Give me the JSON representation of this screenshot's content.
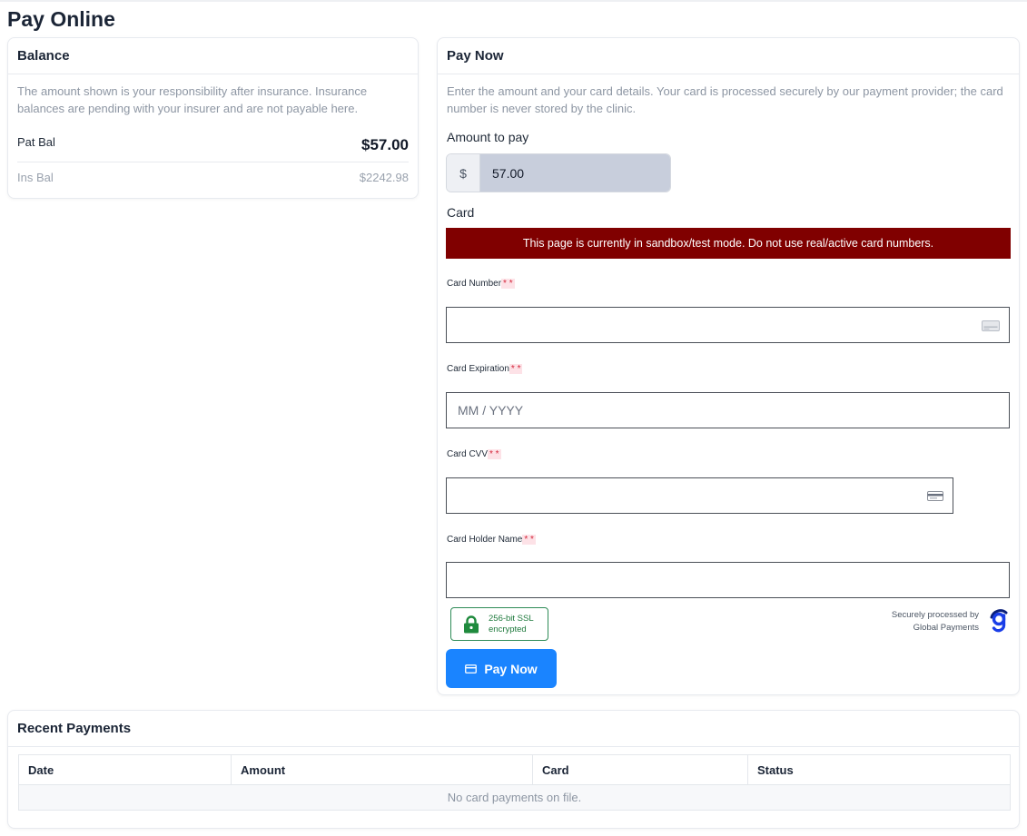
{
  "page": {
    "title": "Pay Online"
  },
  "balance": {
    "header": "Balance",
    "description": "The amount shown is your responsibility after insurance. Insurance balances are pending with your insurer and are not payable here.",
    "patient_label": "Pat Bal",
    "patient_value": "$57.00",
    "insurance_label": "Ins Bal",
    "insurance_value": "$2242.98"
  },
  "pay": {
    "header": "Pay Now",
    "description": "Enter the amount and your card details. Your card is processed securely by our payment provider; the card number is never stored by the clinic.",
    "amount_label": "Amount to pay",
    "currency_symbol": "$",
    "amount_value": "57.00",
    "card_label": "Card",
    "sandbox_notice": "This page is currently in sandbox/test mode. Do not use real/active card numbers.",
    "required_marker": "* *",
    "fields": {
      "card_number": {
        "label": "Card Number",
        "placeholder": "",
        "icon": "credit-card-icon"
      },
      "card_expiration": {
        "label": "Card Expiration",
        "placeholder": "MM / YYYY"
      },
      "card_cvv": {
        "label": "Card CVV",
        "placeholder": "",
        "icon": "card-back-icon"
      },
      "card_holder": {
        "label": "Card Holder Name",
        "placeholder": ""
      }
    },
    "ssl_badge": {
      "line1": "256-bit SSL",
      "line2": "encrypted",
      "icon": "lock-icon"
    },
    "processor": {
      "line1": "Securely processed by",
      "line2": "Global Payments",
      "logo": "global-payments-logo"
    },
    "button_label": "Pay Now",
    "button_icon": "credit-card-icon"
  },
  "recent": {
    "header": "Recent Payments",
    "columns": [
      "Date",
      "Amount",
      "Card",
      "Status"
    ],
    "empty_message": "No card payments on file."
  },
  "colors": {
    "primary_button": "#1a84ff",
    "sandbox_banner": "#800000",
    "ssl_green": "#1f7a3d",
    "amount_input_bg": "#c8cedc"
  }
}
